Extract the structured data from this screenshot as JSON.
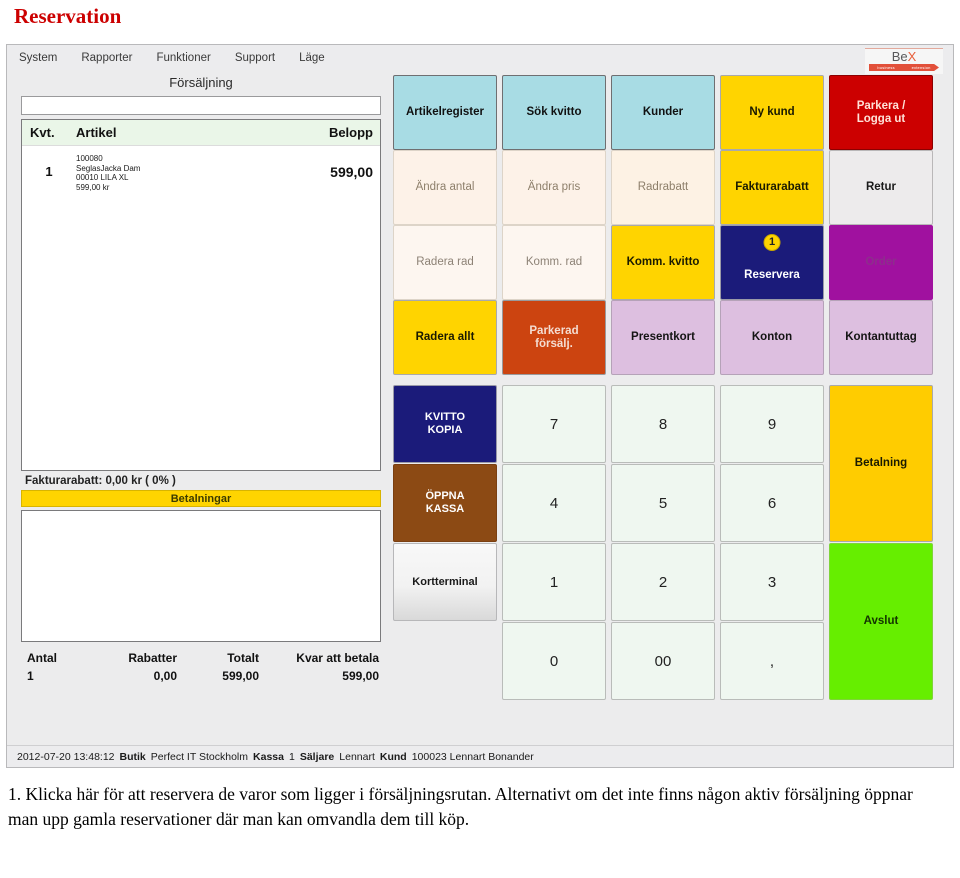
{
  "document": {
    "title": "Reservation",
    "caption": "1. Klicka här för att reservera de varor som ligger i försäljningsrutan. Alternativt om det inte finns någon aktiv försäljning öppnar man upp gamla reservationer där man kan omvandla dem till köp."
  },
  "colors": {
    "title_red": "#cc0000",
    "accent_yellow": "#ffd400",
    "accent_red": "#cc0000",
    "accent_navy": "#1b1b7a",
    "accent_purple": "#a0119f",
    "accent_orange": "#cc4410",
    "accent_green": "#66ee00",
    "accent_lightblue": "#a8dce4",
    "accent_lilac": "#ddbfe0",
    "accent_brown": "#8c4a14",
    "accent_cream": "#fdf4ec"
  },
  "menubar": {
    "items": [
      "System",
      "Rapporter",
      "Funktioner",
      "Support",
      "Läge"
    ],
    "logo": {
      "word_1": "Be",
      "word_2": "X",
      "tagline_1": "business",
      "tagline_2": "extension"
    }
  },
  "sale_panel": {
    "title": "Försäljning",
    "search_input": {
      "value": "",
      "placeholder": ""
    },
    "table": {
      "headers": [
        "Kvt.",
        "Artikel",
        "Belopp"
      ],
      "rows": [
        {
          "kvt": "1",
          "article_lines": [
            "100080",
            "SeglasJacka Dam",
            "00010 LILA XL",
            "599,00 kr"
          ],
          "amount": "599,00"
        }
      ]
    },
    "invoice_discount": "Fakturarabatt:  0,00 kr ( 0% )",
    "payments_title": "Betalningar",
    "payments_rows": [],
    "footer": {
      "labels": [
        "Antal",
        "Rabatter",
        "Totalt",
        "Kvar att betala"
      ],
      "values": [
        "1",
        "0,00",
        "599,00",
        "599,00"
      ]
    }
  },
  "buttons": [
    {
      "label": "Artikelregister",
      "bg": "#a8dce4",
      "fg": "#111111",
      "border": "#6f6f71",
      "bold": true,
      "col": 0,
      "row": 0,
      "colspan": 1,
      "rowspan": 1
    },
    {
      "label": "Sök kvitto",
      "bg": "#a8dce4",
      "fg": "#111111",
      "border": "#6f6f71",
      "bold": true,
      "col": 1,
      "row": 0,
      "colspan": 1,
      "rowspan": 1
    },
    {
      "label": "Kunder",
      "bg": "#a8dce4",
      "fg": "#111111",
      "border": "#6f6f71",
      "bold": true,
      "col": 2,
      "row": 0,
      "colspan": 1,
      "rowspan": 1
    },
    {
      "label": "Ny kund",
      "bg": "#ffd400",
      "fg": "#1a1a00",
      "border": "#a9a9ab",
      "bold": true,
      "col": 3,
      "row": 0,
      "colspan": 1,
      "rowspan": 1
    },
    {
      "label": "Parkera /\nLogga ut",
      "bg": "#cc0000",
      "fg": "#ffe2d8",
      "border": "#8c0000",
      "bold": true,
      "col": 4,
      "row": 0,
      "colspan": 1,
      "rowspan": 1
    },
    {
      "label": "Ändra antal",
      "bg": "#fdf2e8",
      "fg": "#8d7f6a",
      "border": "#ddd4c8",
      "bold": false,
      "col": 0,
      "row": 1,
      "colspan": 1,
      "rowspan": 1
    },
    {
      "label": "Ändra pris",
      "bg": "#fdf2e8",
      "fg": "#8d7f6a",
      "border": "#ddd4c8",
      "bold": false,
      "col": 1,
      "row": 1,
      "colspan": 1,
      "rowspan": 1
    },
    {
      "label": "Radrabatt",
      "bg": "#fdf2e4",
      "fg": "#8d7f6a",
      "border": "#ddd4c8",
      "bold": false,
      "col": 2,
      "row": 1,
      "colspan": 1,
      "rowspan": 1
    },
    {
      "label": "Fakturarabatt",
      "bg": "#ffd400",
      "fg": "#1a1a00",
      "border": "#a9a9ab",
      "bold": true,
      "col": 3,
      "row": 1,
      "colspan": 1,
      "rowspan": 1
    },
    {
      "label": "Retur",
      "bg": "#edebec",
      "fg": "#1a1a1a",
      "border": "#b9b7b8",
      "bold": true,
      "col": 4,
      "row": 1,
      "colspan": 1,
      "rowspan": 1
    },
    {
      "label": "Radera rad",
      "bg": "#fdf6f0",
      "fg": "#8d8276",
      "border": "#ddd4c8",
      "bold": false,
      "col": 0,
      "row": 2,
      "colspan": 1,
      "rowspan": 1
    },
    {
      "label": "Komm. rad",
      "bg": "#fdf6f0",
      "fg": "#8d8276",
      "border": "#ddd4c8",
      "bold": false,
      "col": 1,
      "row": 2,
      "colspan": 1,
      "rowspan": 1
    },
    {
      "label": "Komm. kvitto",
      "bg": "#ffd400",
      "fg": "#1a1a00",
      "border": "#a9a9ab",
      "bold": true,
      "col": 2,
      "row": 2,
      "colspan": 1,
      "rowspan": 1
    },
    {
      "label": "Reservera",
      "bg": "#1b1b7a",
      "fg": "#ffffff",
      "border": "#9a9aa8",
      "bold": true,
      "col": 3,
      "row": 2,
      "colspan": 1,
      "rowspan": 1,
      "badge": "1"
    },
    {
      "label": "Order",
      "bg": "#a0119f",
      "fg": "#8e2d8d",
      "border": "#a0119f",
      "bold": true,
      "col": 4,
      "row": 2,
      "colspan": 1,
      "rowspan": 1
    },
    {
      "label": "Radera allt",
      "bg": "#ffd400",
      "fg": "#1a1a00",
      "border": "#a9a9ab",
      "bold": true,
      "col": 0,
      "row": 3,
      "colspan": 1,
      "rowspan": 1
    },
    {
      "label": "Parkerad\nförsälj.",
      "bg": "#cc4410",
      "fg": "#f4ddd2",
      "border": "#9a9a9c",
      "bold": true,
      "col": 1,
      "row": 3,
      "colspan": 1,
      "rowspan": 1
    },
    {
      "label": "Presentkort",
      "bg": "#ddbfe0",
      "fg": "#141414",
      "border": "#b5a2b8",
      "bold": true,
      "col": 2,
      "row": 3,
      "colspan": 1,
      "rowspan": 1
    },
    {
      "label": "Konton",
      "bg": "#ddbfe0",
      "fg": "#141414",
      "border": "#b5a2b8",
      "bold": true,
      "col": 3,
      "row": 3,
      "colspan": 1,
      "rowspan": 1
    },
    {
      "label": "Kontantuttag",
      "bg": "#ddbfe0",
      "fg": "#141414",
      "border": "#b5a2b8",
      "bold": true,
      "col": 4,
      "row": 3,
      "colspan": 1,
      "rowspan": 1
    }
  ],
  "keypad": [
    {
      "label": "KVITTO\nKOPIA",
      "bg": "#1b1b7a",
      "fg": "#ffffff",
      "border": "#9a9aa8",
      "bold": true,
      "col": 0,
      "row": 0,
      "rowspan": 1,
      "size": 11
    },
    {
      "label": "ÖPPNA\nKASSA",
      "bg": "#8c4a14",
      "fg": "#ffffff",
      "border": "#7a3f11",
      "bold": true,
      "col": 0,
      "row": 1,
      "rowspan": 1,
      "size": 11
    },
    {
      "label": "Kortterminal",
      "bg": "#eeeeee",
      "fg": "#1a1a1a",
      "border": "#b7b7b9",
      "bold": true,
      "col": 0,
      "row": 2,
      "rowspan": 1,
      "size": 11,
      "gradient": true
    },
    {
      "label": "7",
      "bg": "#eff7f0",
      "fg": "#222222",
      "border": "#b9bcb9",
      "bold": false,
      "col": 1,
      "row": 0,
      "rowspan": 1,
      "size": 15
    },
    {
      "label": "8",
      "bg": "#eff7f0",
      "fg": "#222222",
      "border": "#b9bcb9",
      "bold": false,
      "col": 2,
      "row": 0,
      "rowspan": 1,
      "size": 15
    },
    {
      "label": "9",
      "bg": "#eff7f0",
      "fg": "#222222",
      "border": "#b9bcb9",
      "bold": false,
      "col": 3,
      "row": 0,
      "rowspan": 1,
      "size": 15
    },
    {
      "label": "4",
      "bg": "#eff7f0",
      "fg": "#222222",
      "border": "#b9bcb9",
      "bold": false,
      "col": 1,
      "row": 1,
      "rowspan": 1,
      "size": 15
    },
    {
      "label": "5",
      "bg": "#eff7f0",
      "fg": "#222222",
      "border": "#b9bcb9",
      "bold": false,
      "col": 2,
      "row": 1,
      "rowspan": 1,
      "size": 15
    },
    {
      "label": "6",
      "bg": "#eff7f0",
      "fg": "#222222",
      "border": "#b9bcb9",
      "bold": false,
      "col": 3,
      "row": 1,
      "rowspan": 1,
      "size": 15
    },
    {
      "label": "1",
      "bg": "#eff7f0",
      "fg": "#222222",
      "border": "#b9bcb9",
      "bold": false,
      "col": 1,
      "row": 2,
      "rowspan": 1,
      "size": 15
    },
    {
      "label": "2",
      "bg": "#eff7f0",
      "fg": "#222222",
      "border": "#b9bcb9",
      "bold": false,
      "col": 2,
      "row": 2,
      "rowspan": 1,
      "size": 15
    },
    {
      "label": "3",
      "bg": "#eff7f0",
      "fg": "#222222",
      "border": "#b9bcb9",
      "bold": false,
      "col": 3,
      "row": 2,
      "rowspan": 1,
      "size": 15
    },
    {
      "label": "0",
      "bg": "#eff7f0",
      "fg": "#222222",
      "border": "#b9bcb9",
      "bold": false,
      "col": 1,
      "row": 3,
      "rowspan": 1,
      "size": 15
    },
    {
      "label": "00",
      "bg": "#eff7f0",
      "fg": "#222222",
      "border": "#b9bcb9",
      "bold": false,
      "col": 2,
      "row": 3,
      "rowspan": 1,
      "size": 15
    },
    {
      "label": ",",
      "bg": "#eff7f0",
      "fg": "#222222",
      "border": "#b9bcb9",
      "bold": false,
      "col": 3,
      "row": 3,
      "rowspan": 1,
      "size": 15
    },
    {
      "label": "Betalning",
      "bg": "#ffcc00",
      "fg": "#1a1a00",
      "border": "#a9a9ab",
      "bold": true,
      "col": 4,
      "row": 0,
      "rowspan": 2,
      "size": 11.5
    },
    {
      "label": "Avslut",
      "bg": "#66ee00",
      "fg": "#133300",
      "border": "#7fd43a",
      "bold": true,
      "col": 4,
      "row": 2,
      "rowspan": 2,
      "size": 11.5
    }
  ],
  "statusbar": {
    "timestamp": "2012-07-20 13:48:12",
    "store_label": "Butik",
    "store_value": "Perfect IT Stockholm",
    "register_label": "Kassa",
    "register_value": "1",
    "seller_label": "Säljare",
    "seller_value": "Lennart",
    "customer_label": "Kund",
    "customer_value": "100023 Lennart Bonander"
  }
}
